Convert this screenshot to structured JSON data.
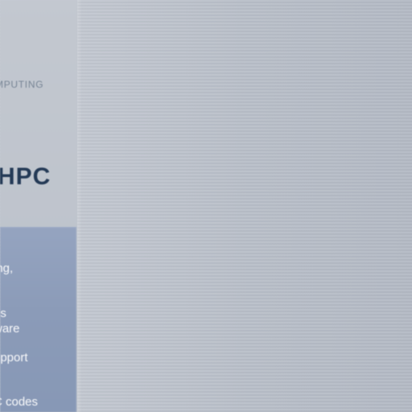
{
  "left_panel": {
    "kicker": "MPUTING",
    "title": "HPC",
    "features": [
      "ing,\n",
      "es\nware",
      "upport\nt",
      "C codes"
    ]
  }
}
